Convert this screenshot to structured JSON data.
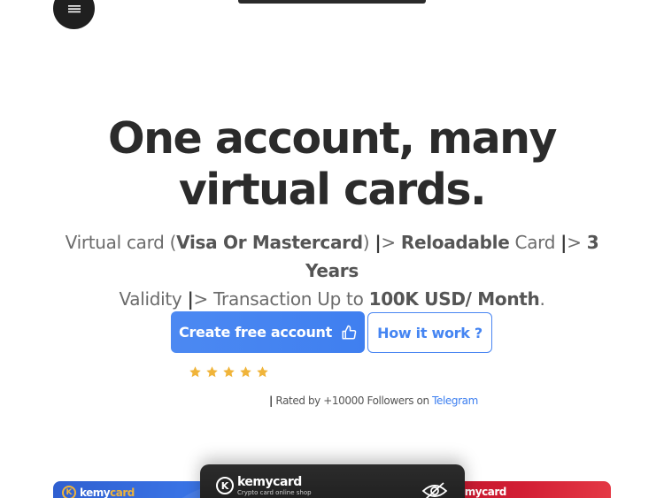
{
  "header": {
    "menu_icon": "hamburger-menu-icon"
  },
  "hero": {
    "title": "One account, many virtual cards.",
    "subtitle": {
      "p1": "Virtual card (",
      "p2": "Visa Or Mastercard",
      "p3": ") ",
      "sep": "|",
      "arrow": ">",
      "p4": "Reloadable",
      "p5": " Card ",
      "p6": "3 Years",
      "p7": "Validity ",
      "p8": " Transaction Up to ",
      "p9": "100K USD/ Month",
      "p10": "."
    }
  },
  "actions": {
    "primary_label": "Create free account",
    "primary_icon": "thumbs-up-icon",
    "secondary_label": "How it work ?"
  },
  "rating": {
    "stars": 5,
    "star_color": "#f0b43a",
    "bar": "|",
    "text": " Rated by +10000 Followers on ",
    "link": "Telegram"
  },
  "cards": {
    "brand_k": "K",
    "brand_name": "kemycard",
    "brand_name_part1": "kemy",
    "brand_name_part2": "card",
    "tagline": "Crypto card online shop",
    "visibility_icon": "eye-off-icon"
  },
  "colors": {
    "accent": "#4585f2",
    "text_dark": "#2b2b2b",
    "card_blue": "#3a74e6",
    "card_red": "#d21e34",
    "card_dark": "#222222"
  }
}
